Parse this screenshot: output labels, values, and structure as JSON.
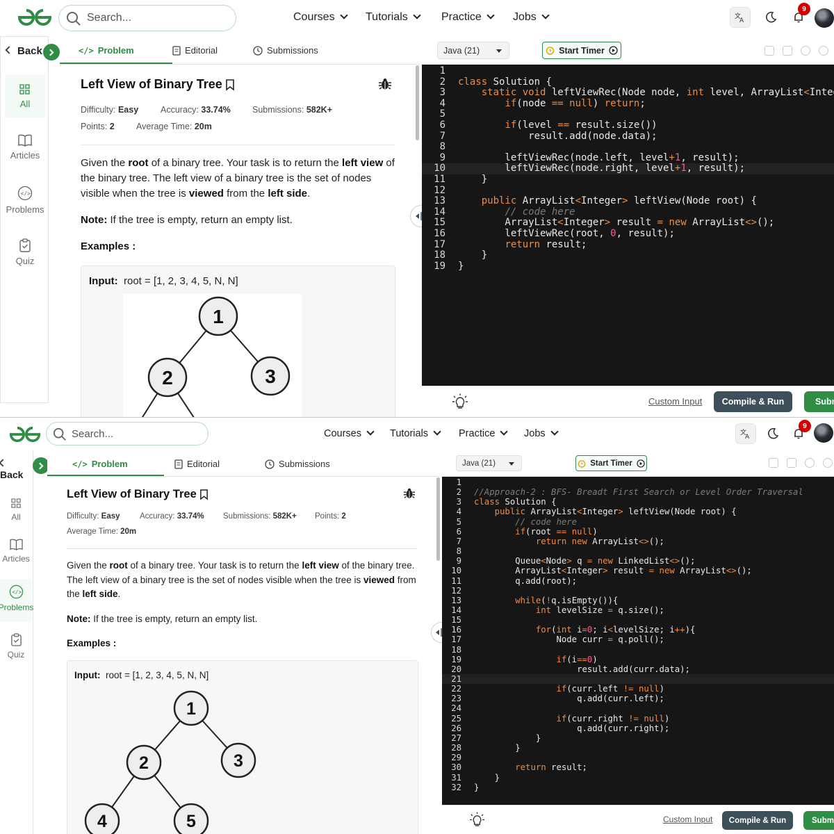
{
  "nav": {
    "search_placeholder": "Search...",
    "menu": [
      {
        "label": "Courses"
      },
      {
        "label": "Tutorials"
      },
      {
        "label": "Practice"
      },
      {
        "label": "Jobs"
      }
    ],
    "notification_count": "9"
  },
  "sidebar": {
    "back_label": "Back",
    "items": [
      {
        "label": "All",
        "icon": "grid-icon"
      },
      {
        "label": "Articles",
        "icon": "book-icon"
      },
      {
        "label": "Problems",
        "icon": "code-icon"
      },
      {
        "label": "Quiz",
        "icon": "clipboard-icon"
      }
    ]
  },
  "tabs": {
    "problem": "Problem",
    "editorial": "Editorial",
    "submissions": "Submissions"
  },
  "problem": {
    "title": "Left View of Binary Tree",
    "difficulty_label": "Difficulty:",
    "difficulty": "Easy",
    "accuracy_label": "Accuracy:",
    "accuracy": "33.74%",
    "submissions_label": "Submissions:",
    "submissions": "582K+",
    "points_label": "Points:",
    "points": "2",
    "avg_time_label": "Average Time:",
    "avg_time": "20m",
    "desc_1": "Given the ",
    "desc_root": "root",
    "desc_2": " of a binary tree. Your task is to return the ",
    "desc_leftview": "left view",
    "desc_3": " of the binary tree. The left view of a binary tree is the set of nodes visible when the tree is ",
    "desc_viewed": "viewed",
    "desc_4": " from the ",
    "desc_leftside": "left side",
    "desc_5": ".",
    "note_label": "Note:",
    "note_text": " If the tree is empty, return an empty list.",
    "examples_label": "Examples :",
    "input_label": "Input:",
    "input_value": "root = [1, 2, 3, 4, 5, N, N]",
    "tree_nodes": [
      "1",
      "2",
      "3",
      "4",
      "5"
    ]
  },
  "editor": {
    "language": "Java (21)",
    "timer_label": "Start Timer",
    "custom_input": "Custom Input",
    "compile_label": "Compile & Run",
    "submit_label": "Submit"
  },
  "code1": [
    "",
    "class Solution {",
    "    static void leftViewRec(Node node, int level, ArrayList<Integer> result) {",
    "        if(node == null) return;",
    "",
    "        if(level == result.size())",
    "            result.add(node.data);",
    "",
    "        leftViewRec(node.left, level+1, result);",
    "        leftViewRec(node.right, level+1, result);",
    "    }",
    "",
    "    public ArrayList<Integer> leftView(Node root) {",
    "        // code here",
    "        ArrayList<Integer> result = new ArrayList<>();",
    "        leftViewRec(root, 0, result);",
    "        return result;",
    "    }",
    "}"
  ],
  "code2": [
    "",
    "//Approach-2 : BFS- Breadt First Search or Level Order Traversal",
    "class Solution {",
    "    public ArrayList<Integer> leftView(Node root) {",
    "        // code here",
    "        if(root == null)",
    "            return new ArrayList<>();",
    "",
    "        Queue<Node> q = new LinkedList<>();",
    "        ArrayList<Integer> result = new ArrayList<>();",
    "        q.add(root);",
    "",
    "        while(!q.isEmpty()){",
    "            int levelSize = q.size();",
    "",
    "            for(int i=0; i<levelSize; i++){",
    "                Node curr = q.poll();",
    "",
    "                if(i==0)",
    "                    result.add(curr.data);",
    "",
    "                if(curr.left != null)",
    "                    q.add(curr.left);",
    "",
    "                if(curr.right != null)",
    "                    q.add(curr.right);",
    "            }",
    "        }",
    "",
    "        return result;",
    "    }",
    "}"
  ],
  "colors": {
    "brand_green": "#2f8d46",
    "editor_bg": "#161616",
    "keyword": "#f08c43",
    "number": "#ff5c8a",
    "compile_btn": "#3d4f59",
    "badge": "#d40000"
  }
}
